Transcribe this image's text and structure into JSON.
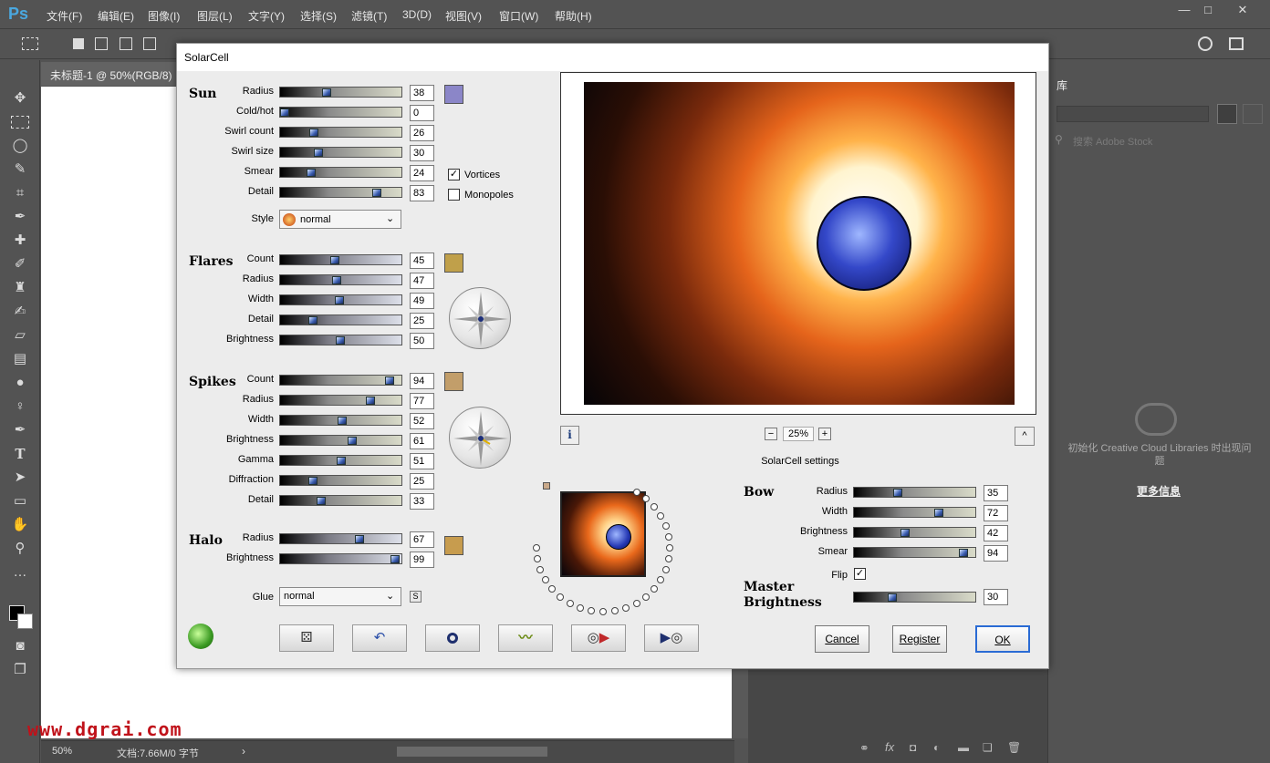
{
  "app": {
    "logo": "Ps",
    "menu": [
      "文件(F)",
      "编辑(E)",
      "图像(I)",
      "图层(L)",
      "文字(Y)",
      "选择(S)",
      "滤镜(T)",
      "3D(D)",
      "视图(V)",
      "窗口(W)",
      "帮助(H)"
    ],
    "window_controls": [
      "—",
      "□",
      "✕"
    ]
  },
  "document": {
    "tab_title": "未标题-1 @ 50%(RGB/8)",
    "zoom": "50%",
    "doc_info": "文档:7.66M/0 字节"
  },
  "library": {
    "tab": "库",
    "search_placeholder": "搜索 Adobe Stock",
    "message": "初始化 Creative Cloud Libraries 时出现问题",
    "more_link": "更多信息"
  },
  "watermark": "www.dgrai.com",
  "dialog": {
    "title": "SolarCell",
    "sun": {
      "heading": "Sun",
      "params": [
        {
          "label": "Radius",
          "value": 38
        },
        {
          "label": "Cold/hot",
          "value": 0
        },
        {
          "label": "Swirl count",
          "value": 26
        },
        {
          "label": "Swirl size",
          "value": 30
        },
        {
          "label": "Smear",
          "value": 24
        },
        {
          "label": "Detail",
          "value": 83
        }
      ],
      "swatch_color": "#8b86c8",
      "vortices_label": "Vortices",
      "vortices_checked": true,
      "monopoles_label": "Monopoles",
      "monopoles_checked": false,
      "style_label": "Style",
      "style_value": "normal"
    },
    "flares": {
      "heading": "Flares",
      "params": [
        {
          "label": "Count",
          "value": 45
        },
        {
          "label": "Radius",
          "value": 47
        },
        {
          "label": "Width",
          "value": 49
        },
        {
          "label": "Detail",
          "value": 25
        },
        {
          "label": "Brightness",
          "value": 50
        }
      ],
      "swatch_color": "#c0a04a"
    },
    "spikes": {
      "heading": "Spikes",
      "params": [
        {
          "label": "Count",
          "value": 94
        },
        {
          "label": "Radius",
          "value": 77
        },
        {
          "label": "Width",
          "value": 52
        },
        {
          "label": "Brightness",
          "value": 61
        },
        {
          "label": "Gamma",
          "value": 51
        },
        {
          "label": "Diffraction",
          "value": 25
        },
        {
          "label": "Detail",
          "value": 33
        }
      ],
      "swatch_color": "#c29e6a"
    },
    "halo": {
      "heading": "Halo",
      "params": [
        {
          "label": "Radius",
          "value": 67
        },
        {
          "label": "Brightness",
          "value": 99
        }
      ],
      "swatch_color": "#c79c4e"
    },
    "glue": {
      "label": "Glue",
      "value": "normal",
      "s_button": "S"
    },
    "preview": {
      "zoom": "25%",
      "minus": "−",
      "plus": "+",
      "info": "i",
      "collapse": "^"
    },
    "settings_label": "SolarCell settings",
    "bow": {
      "heading": "Bow",
      "params": [
        {
          "label": "Radius",
          "value": 35
        },
        {
          "label": "Width",
          "value": 72
        },
        {
          "label": "Brightness",
          "value": 42
        },
        {
          "label": "Smear",
          "value": 94
        }
      ],
      "flip_label": "Flip",
      "flip_checked": true
    },
    "master": {
      "heading_line1": "Master",
      "heading_line2": "Brightness",
      "value": 30
    },
    "buttons": {
      "cancel": "Cancel",
      "register": "Register",
      "ok": "OK"
    },
    "tool_icons": [
      "dice-icon",
      "undo-icon",
      "reset-icon",
      "wave-icon",
      "play-record-icon",
      "play-back-icon"
    ]
  }
}
